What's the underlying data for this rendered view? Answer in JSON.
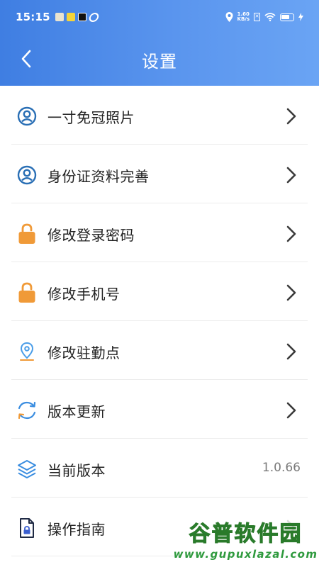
{
  "status_bar": {
    "time": "15:15",
    "net_speed_value": "1.60",
    "net_speed_unit": "KB/s",
    "icons": [
      "app-notification-icon",
      "app-game-icon",
      "tiktok-icon",
      "link-icon",
      "location-icon",
      "sim-icon",
      "wifi-icon",
      "battery-icon",
      "charging-icon"
    ]
  },
  "header": {
    "title": "设置",
    "back_icon": "chevron-left-icon",
    "gradient_start": "#3f7ee2",
    "gradient_end": "#6aa4f4"
  },
  "settings": {
    "items": [
      {
        "label": "一寸免冠照片",
        "icon": "user-circle-icon",
        "icon_color": "#2a6fb5",
        "has_chevron": true
      },
      {
        "label": "身份证资料完善",
        "icon": "user-circle-icon",
        "icon_color": "#2a6fb5",
        "has_chevron": true
      },
      {
        "label": "修改登录密码",
        "icon": "lock-icon",
        "icon_color": "#f09a38",
        "has_chevron": true
      },
      {
        "label": "修改手机号",
        "icon": "lock-icon",
        "icon_color": "#f09a38",
        "has_chevron": true
      },
      {
        "label": "修改驻勤点",
        "icon": "location-pin-icon",
        "icon_color": "#4a9de8",
        "has_chevron": true
      },
      {
        "label": "版本更新",
        "icon": "refresh-icon",
        "icon_color": "#3a8de0",
        "has_chevron": true
      },
      {
        "label": "当前版本",
        "icon": "layers-icon",
        "icon_color": "#3a8de0",
        "value": "1.0.66",
        "has_chevron": false
      },
      {
        "label": "操作指南",
        "icon": "document-lock-icon",
        "icon_color": "#1f3a8a",
        "has_chevron": true
      }
    ]
  },
  "watermark": {
    "title": "谷普软件园",
    "subtitle": "www.gupuxlazal.com"
  }
}
